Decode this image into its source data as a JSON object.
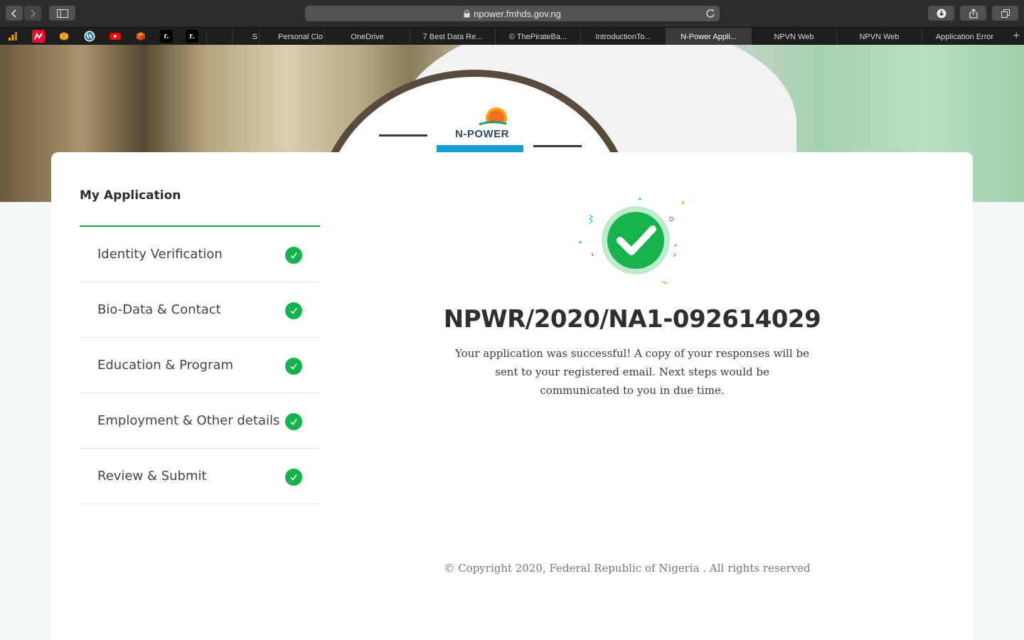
{
  "browser": {
    "url": "npower.fmhds.gov.ng",
    "tabs": [
      {
        "label": "S",
        "active": false
      },
      {
        "label": "Personal Clo",
        "active": false
      },
      {
        "label": "OneDrive",
        "active": false
      },
      {
        "label": "7 Best Data Re...",
        "active": false
      },
      {
        "label": "© ThePirateBa...",
        "active": false
      },
      {
        "label": "IntroductionTo...",
        "active": false
      },
      {
        "label": "N-Power Appli...",
        "active": true
      },
      {
        "label": "NPVN Web",
        "active": false
      },
      {
        "label": "NPVN Web",
        "active": false
      },
      {
        "label": "Application Error",
        "active": false
      }
    ],
    "favicons": [
      "analytics-icon",
      "app-icon",
      "box-icon",
      "wordpress-icon",
      "youtube-icon",
      "cube-icon",
      "r-icon",
      "r-icon",
      "blank-icon"
    ]
  },
  "hero": {
    "logo_text": "N-POWER"
  },
  "sidebar": {
    "title": "My Application",
    "steps": [
      {
        "label": "Identity Verification",
        "complete": true
      },
      {
        "label": "Bio-Data & Contact",
        "complete": true
      },
      {
        "label": "Education & Program",
        "complete": true
      },
      {
        "label": "Employment & Other details",
        "complete": true
      },
      {
        "label": "Review & Submit",
        "complete": true
      }
    ]
  },
  "main": {
    "reference": "NPWR/2020/NA1-092614029",
    "message": "Your application was successful! A copy of your responses will be sent to your registered email. Next steps would be communicated to you in due time.",
    "copyright": "© Copyright 2020, Federal Republic of Nigeria . All rights reserved"
  },
  "colors": {
    "accent": "#1da24a",
    "check": "#13b34b"
  }
}
